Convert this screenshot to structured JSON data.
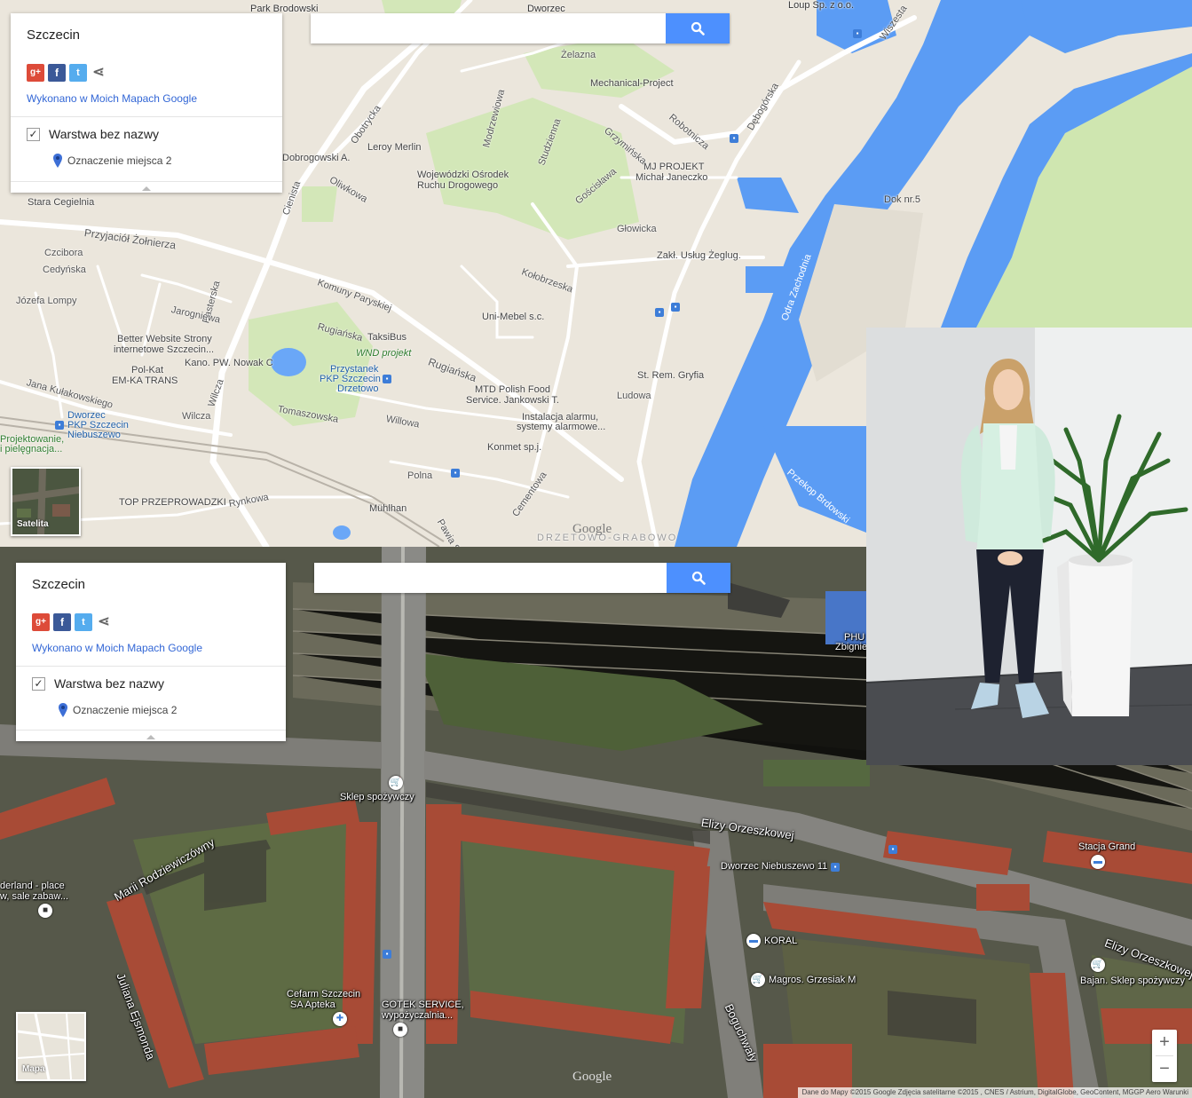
{
  "panel": {
    "title": "Szczecin",
    "made_with": "Wykonano w Moich Mapach Google",
    "layer_name": "Warstwa bez nazwy",
    "placemark": "Oznaczenie miejsca 2",
    "social": {
      "gplus": "g+",
      "facebook": "f",
      "twitter": "t"
    }
  },
  "search": {
    "placeholder": ""
  },
  "toggles": {
    "satellite": "Satelita",
    "map": "Mapa"
  },
  "logo": "Google",
  "road_labels": {
    "park_brodowski": "Park Brodowski",
    "dworzec_top": "Dworzec",
    "loup": "Loup Sp. z o.o.",
    "wiszesta": "Wiszesta",
    "zelazna": "Żelazna",
    "mechanical": "Mechanical-Project",
    "dabogorska": "Dębogórska",
    "robotnicza": "Robotnicza",
    "obotrycka": "Obotrycka",
    "modrzewiowa": "Modrzewiowa",
    "studzienna": "Studzienna",
    "grzyminska": "Grzymińska",
    "dobrogowski": "Dobrogowski A.",
    "leroy": "Leroy Merlin",
    "mj1": "MJ PROJEKT",
    "mj2": "Michał Janeczko",
    "osrodek1": "Wojewódzki Ośrodek",
    "osrodek2": "Ruchu Drogowego",
    "oliwkowa": "Oliwkowa",
    "goscislawa": "Gościsława",
    "dok": "Dok nr.5",
    "stara_cegielnia": "Stara Cegielnia",
    "cienista": "Cienista",
    "glowicka": "Głowicka",
    "przyjaciol": "Przyjaciół Żołnierza",
    "kolobrzeska": "Kołobrzeska",
    "zakl": "Zakł. Usług Żeglug.",
    "odra": "Odra Zachodnia",
    "czcibora": "Czcibora",
    "cedynska": "Cedyńska",
    "komuny": "Komuny Paryskiej",
    "pasterska": "Pasterska",
    "jozefa": "Józefa Lompy",
    "jarogniewa": "Jarogniewa",
    "unimebel": "Uni-Mebel s.c.",
    "ruglanska1": "Rugiańska",
    "taksibus": "TaksiBus",
    "better1": "Better Website Strony",
    "better2": "internetowe Szczecin...",
    "wnd": "WND projekt",
    "ruglanska2": "Rugiańska",
    "polkat": "Pol-Kat",
    "kano": "Kano. PW. Nowak C",
    "przystanek1": "Przystanek",
    "przystanek2": "PKP Szczecin",
    "przystanek3": "Drzetowo",
    "emka": "EM-KA TRANS",
    "kulakowskiego": "Jana Kułakowskiego",
    "wilcza1": "Wilcza",
    "tomaszowska": "Tomaszowska",
    "mtd1": "MTD Polish Food",
    "mtd2": "Service. Jankowski T.",
    "ludowa": "Ludowa",
    "gryfia": "St. Rem. Gryfia",
    "dworzec1": "Dworzec",
    "dworzec2": "PKP Szczecin",
    "dworzec3": "Niebuszewo",
    "wilcza2": "Wilcza",
    "willowa": "Willowa",
    "instalacja1": "Instalacja alarmu,",
    "instalacja2": "systemy alarmowe...",
    "projektowanie1": "Projektowanie,",
    "projektowanie2": "i pielęgnacja...",
    "konmet": "Konmet sp.j.",
    "przekop": "Przekop Brdowski",
    "polna": "Polna",
    "top": "TOP PRZEPROWADZKI",
    "rynkowa": "Rynkowa",
    "cementowa": "Cementowa",
    "muhlhan": "Mühlhan",
    "pawia": "Pawia Stal",
    "drzetowo": "DRZETOWO-GRABOWO"
  },
  "sat_labels": {
    "phu1": "PHU",
    "phu2": "Zbignie",
    "sklep": "Sklep spożywczy",
    "elizy1": "Elizy Orzeszkowej",
    "dworzec": "Dworzec Niebuszewo 11",
    "stacja": "Stacja Grand",
    "marii": "Marii Rodziewiczówny",
    "wonderland1": "derland - place",
    "wonderland2": "w, sale zabaw...",
    "koral": "KORAL",
    "elizy2": "Elizy Orzeszkowej",
    "magros": "Magros. Grzesiak M",
    "bajan": "Bajan. Sklep spożywczy",
    "juliana": "Juliana Ejsmonda",
    "cefarm1": "Cefarm Szczecin",
    "cefarm2": "SA Apteka",
    "gotek1": "GOTEK SERVICE,",
    "gotek2": "wypożyczalnia...",
    "boguchwaly": "Boguchwały"
  },
  "zoom": {
    "in": "+",
    "out": "−"
  },
  "attribution": "Dane do Mapy ©2015 Google Zdjęcia satelitarne ©2015 , CNES / Astrium, DigitalGlobe, GeoContent, MGGP Aero   Warunki",
  "colors": {
    "water": "#5b9cf4",
    "park": "#cfe6b0",
    "land": "#ebe6dc",
    "road": "#ffffff",
    "accent": "#4d90fe"
  },
  "icons": [
    "search-icon",
    "share-icon",
    "checkbox-icon",
    "placemark-pin-icon",
    "transit-icon",
    "shop-icon",
    "pharmacy-icon",
    "hotel-icon"
  ]
}
